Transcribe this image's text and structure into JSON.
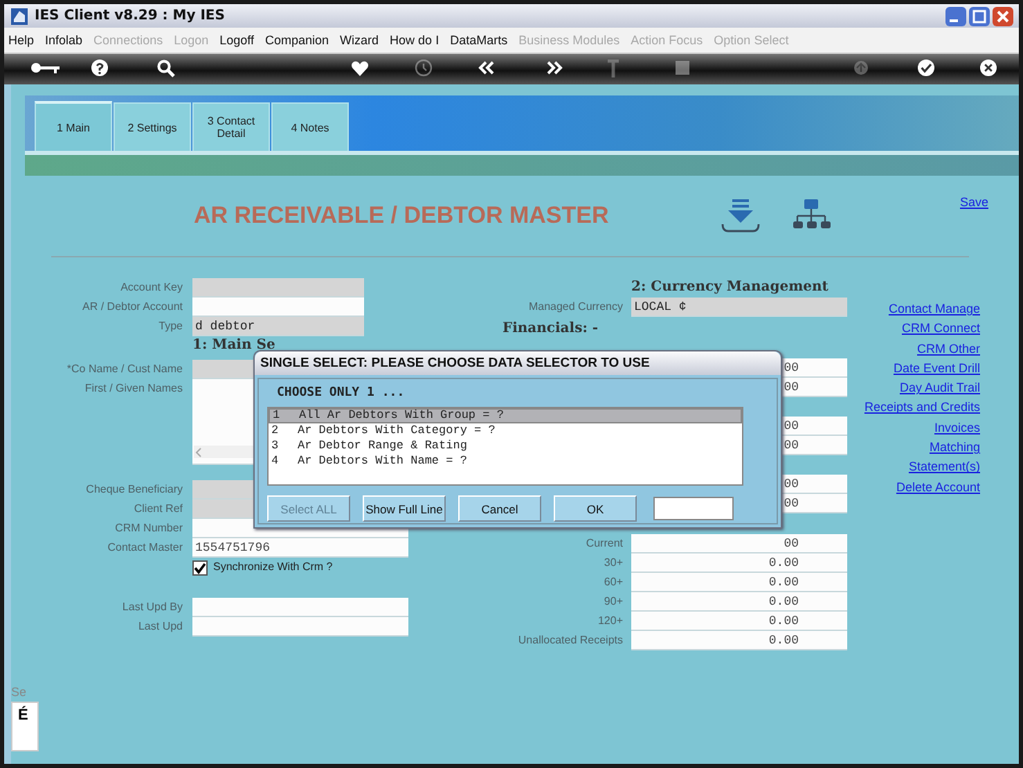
{
  "window": {
    "title": "IES Client v8.29 : My IES"
  },
  "menu": [
    {
      "label": "Help",
      "disabled": false
    },
    {
      "label": "Infolab",
      "disabled": false
    },
    {
      "label": "Connections",
      "disabled": true
    },
    {
      "label": "Logon",
      "disabled": true
    },
    {
      "label": "Logoff",
      "disabled": false
    },
    {
      "label": "Companion",
      "disabled": false
    },
    {
      "label": "Wizard",
      "disabled": false
    },
    {
      "label": "How do I",
      "disabled": false
    },
    {
      "label": "DataMarts",
      "disabled": false
    },
    {
      "label": "Business Modules",
      "disabled": true
    },
    {
      "label": "Action Focus",
      "disabled": true
    },
    {
      "label": "Option Select",
      "disabled": true
    }
  ],
  "toolbar": [
    {
      "kind": "key",
      "disabled": false
    },
    {
      "kind": "help",
      "disabled": false
    },
    {
      "kind": "search",
      "disabled": false
    },
    {
      "kind": "heart",
      "disabled": false
    },
    {
      "kind": "clock",
      "disabled": true
    },
    {
      "kind": "back",
      "disabled": false
    },
    {
      "kind": "forward",
      "disabled": false
    },
    {
      "kind": "pin",
      "disabled": true
    },
    {
      "kind": "stop",
      "disabled": true
    },
    {
      "kind": "recycle",
      "disabled": true
    },
    {
      "kind": "check",
      "disabled": false
    },
    {
      "kind": "close",
      "disabled": false
    }
  ],
  "tabs": [
    {
      "label": "1 Main",
      "selected": true
    },
    {
      "label": "2 Settings",
      "selected": false
    },
    {
      "label": "3 Contact Detail",
      "selected": false
    },
    {
      "label": "4 Notes",
      "selected": false
    }
  ],
  "page_title": "AR RECEIVABLE / DEBTOR MASTER",
  "save_link": "Save",
  "left_groups": [
    [
      {
        "kind": "field",
        "label": "Account Key",
        "readonly": true
      },
      {
        "kind": "field",
        "label": "AR / Debtor Account",
        "readonly": false
      },
      {
        "kind": "field",
        "label": "Type",
        "readonly": true,
        "value": "d debtor"
      },
      {
        "kind": "heading",
        "label": "1: Main Se"
      }
    ],
    [
      {
        "kind": "field",
        "label": "*Co Name / Cust Name",
        "readonly": true
      },
      {
        "kind": "textarea",
        "label": "First / Given Names",
        "readonly": false
      }
    ],
    [
      {
        "kind": "field",
        "label": "Cheque Beneficiary",
        "readonly": true
      },
      {
        "kind": "field",
        "label": "Client Ref",
        "readonly": true
      },
      {
        "kind": "field",
        "label": "CRM Number",
        "readonly": false
      },
      {
        "kind": "field",
        "label": "Contact Master",
        "readonly": false,
        "value": "1554751796"
      },
      {
        "kind": "checkbox",
        "label": "Synchronize With Crm ?",
        "checked": true
      }
    ],
    [
      {
        "kind": "field",
        "label": "Last Upd By",
        "readonly": false
      },
      {
        "kind": "field",
        "label": "Last Upd",
        "readonly": false
      }
    ]
  ],
  "currency": {
    "heading": "2: Currency Management",
    "label": "Managed Currency",
    "value": "LOCAL ¢"
  },
  "financials_heading": "Financials: -",
  "financial_groups": [
    [
      {
        "value": "00"
      },
      {
        "value": "00"
      }
    ],
    [
      {
        "value": "00"
      },
      {
        "value": "00"
      }
    ],
    [
      {
        "value": "00"
      },
      {
        "value": "00"
      }
    ],
    [
      {
        "label": "Current",
        "value": "00"
      },
      {
        "label": "30+",
        "value": "0.00"
      },
      {
        "label": "60+",
        "value": "0.00"
      },
      {
        "label": "90+",
        "value": "0.00"
      },
      {
        "label": "120+",
        "value": "0.00"
      },
      {
        "label": "Unallocated Receipts",
        "value": "0.00"
      }
    ]
  ],
  "links": [
    "Contact Manage",
    "CRM Connect",
    "CRM Other",
    "Date Event Drill",
    "Day Audit Trail",
    "Receipts and Credits",
    "Invoices",
    "Matching",
    "Statement(s)",
    "Delete Account"
  ],
  "side_panel": {
    "tab": "Se",
    "letter": "É"
  },
  "dialog": {
    "title": "SINGLE SELECT: PLEASE CHOOSE DATA SELECTOR TO USE",
    "prompt": "CHOOSE ONLY 1 ...",
    "items": [
      {
        "number": "1",
        "text": "All Ar Debtors With Group = ?",
        "selected": true
      },
      {
        "number": "2",
        "text": "Ar Debtors With Category = ?",
        "selected": false
      },
      {
        "number": "3",
        "text": "Ar Debtor Range & Rating",
        "selected": false
      },
      {
        "number": "4",
        "text": "Ar Debtors With Name = ?",
        "selected": false
      }
    ],
    "buttons": [
      {
        "label": "Select ALL",
        "disabled": true
      },
      {
        "label": "Show Full Line",
        "disabled": false
      },
      {
        "label": "Cancel",
        "disabled": false
      },
      {
        "label": "OK",
        "disabled": false
      }
    ]
  }
}
